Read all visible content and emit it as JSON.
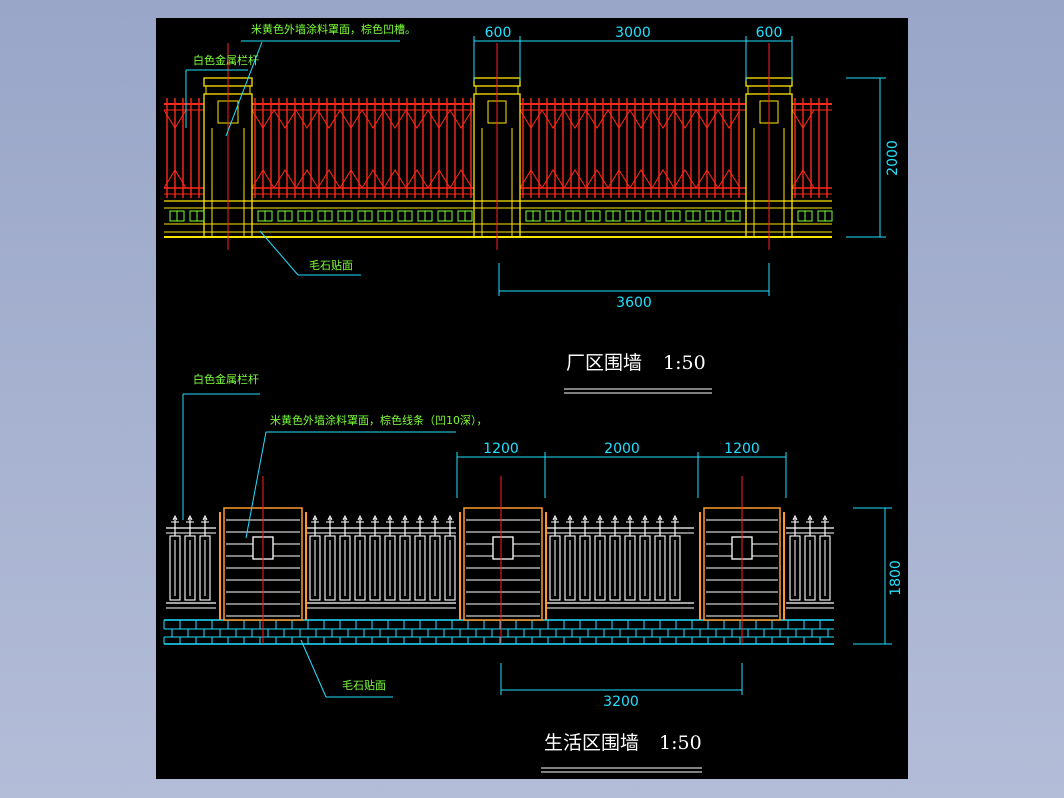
{
  "colors": {
    "background": "#000000",
    "frame": "#b3bdd8",
    "annotation": "#7cff3a",
    "dimension": "#21e0ff",
    "fence_red": "#ff2a1a",
    "outline_yellow": "#ffe600",
    "pillar_orange": "#ff9a2a",
    "centerline": "#ff2020",
    "white": "#ffffff"
  },
  "top_wall": {
    "title": "厂区围墙",
    "scale": "1:50",
    "note_coating": "米黄色外墙涂料罩面，棕色凹槽。",
    "note_railing": "白色金属栏杆",
    "note_base": "毛石贴面",
    "dims": {
      "left": "600",
      "middle": "3000",
      "right": "600",
      "height": "2000",
      "span": "3600"
    }
  },
  "bottom_wall": {
    "title": "生活区围墙",
    "scale": "1:50",
    "note_railing": "白色金属栏杆",
    "note_coating": "米黄色外墙涂料罩面，棕色线条（凹10深），",
    "note_base": "毛石贴面",
    "dims": {
      "left": "1200",
      "middle": "2000",
      "right": "1200",
      "height": "1800",
      "span": "3200"
    }
  }
}
